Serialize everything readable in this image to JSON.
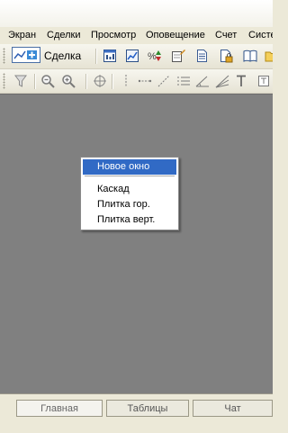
{
  "menu": {
    "items": [
      "Экран",
      "Сделки",
      "Просмотр",
      "Оповещение",
      "Счет",
      "Систе"
    ]
  },
  "toolbar": {
    "deal_label": "Сделка",
    "row1_icons": [
      "chart-window-icon",
      "line-chart-icon",
      "percent-arrow-icon",
      "note-edit-icon",
      "document-icon",
      "lock-document-icon",
      "book-icon",
      "folder-icon"
    ],
    "row2_icons": [
      "filter-icon",
      "zoom-out-icon",
      "zoom-in-icon",
      "crosshair-icon",
      "vertical-line-icon",
      "horizontal-line-icon",
      "trend-line-icon",
      "channels-icon",
      "angle-line-icon",
      "fan-icon",
      "text-icon"
    ]
  },
  "context_menu": {
    "items": [
      "Новое окно",
      "Каскад",
      "Плитка гор.",
      "Плитка верт."
    ],
    "selected_index": 0
  },
  "tabs": [
    "Главная",
    "Таблицы",
    "Чат"
  ],
  "colors": {
    "workspace": "#808080",
    "selection": "#316ac5",
    "menubar": "#ece9d8"
  }
}
